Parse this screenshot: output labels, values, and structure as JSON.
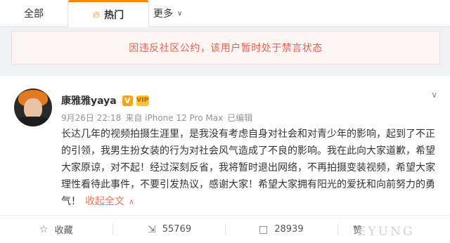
{
  "tabs": {
    "all_label": "全部",
    "hot_label": "热门",
    "more_label": "更多"
  },
  "notice": {
    "text": "因违反社区公约，该用户暂时处于禁言状态"
  },
  "post": {
    "username": "康雅雅yaya",
    "verified_badge": "V",
    "member_badge": "VIP",
    "time": "9月26日 22:18",
    "source": "来自 iPhone 12 Pro Max",
    "edited": "已编辑",
    "content": "长达几年的视频拍摄生涯里，是我没有考虑自身对社会和对青少年的影响，起到了不正的引领，我男生扮女装的行为对社会风气造成了不良的影响。我在此向大家道歉，希望大家原谅，对不起！经过深刻反省，我将暂时退出网络，不再拍摄变装视频，希望大家理性看待此事件，不要引发热议，感谢大家！希望大家拥有阳光的爱抚和向前努力的勇气！",
    "collapse_label": "收起全文"
  },
  "actions": {
    "favorite_label": "收藏",
    "repost_count": "55769",
    "comment_count": "28939",
    "like_label": "赞"
  },
  "watermark": "EYUNG",
  "colors": {
    "accent": "#ff8200",
    "notice_text": "#e8604c",
    "link": "#eb7350"
  }
}
